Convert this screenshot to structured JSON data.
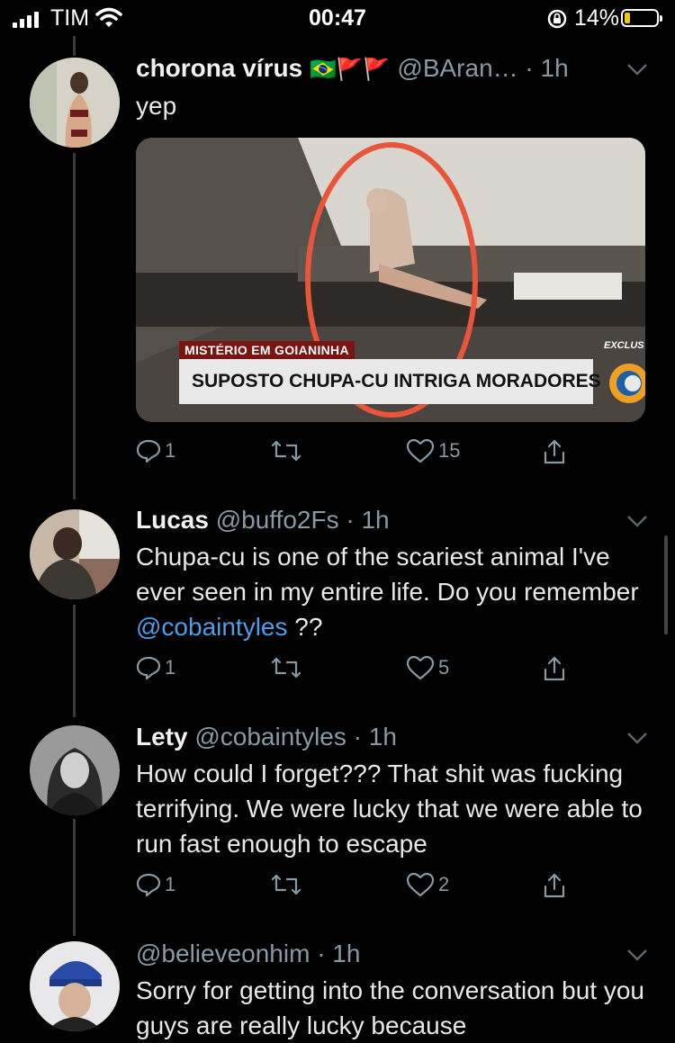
{
  "status_bar": {
    "carrier": "TIM",
    "time": "00:47",
    "battery": "14%",
    "battery_level": 0.14
  },
  "tweets": [
    {
      "name": "chorona vírus",
      "flags": "🇧🇷🚩🚩",
      "handle": "@BAran…",
      "time": "· 1h",
      "text": "yep",
      "media": {
        "top_label": "MISTÉRIO EM GOIANINHA",
        "headline": "SUPOSTO CHUPA-CU INTRIGA MORADORES",
        "corner_label": "EXCLUS"
      },
      "actions": {
        "replies": "1",
        "likes": "15"
      }
    },
    {
      "name": "Lucas",
      "handle": "@buffo2Fs",
      "time": "· 1h",
      "text_parts": [
        "Chupa-cu is one of the scariest animal I've ever seen in my entire life. Do you remember ",
        "@cobaintyles",
        " ??"
      ],
      "actions": {
        "replies": "1",
        "likes": "5"
      }
    },
    {
      "name": "Lety",
      "handle": "@cobaintyles",
      "time": "· 1h",
      "text": "How could I forget??? That shit was fucking terrifying. We were lucky that we were able to run fast enough to escape",
      "actions": {
        "replies": "1",
        "likes": "2"
      }
    },
    {
      "handle": "@believeonhim",
      "time": "· 1h",
      "text": "Sorry for getting into the conversation but you guys are really lucky because"
    }
  ],
  "icons": [
    "signal-icon",
    "wifi-icon",
    "orientation-lock-icon",
    "battery-icon",
    "chevron-down-icon",
    "reply-icon",
    "retweet-icon",
    "like-icon",
    "share-icon"
  ],
  "colors": {
    "background": "#000000",
    "handle": "#8899a6",
    "mention": "#4a9fe8",
    "circle": "#e8553a"
  }
}
